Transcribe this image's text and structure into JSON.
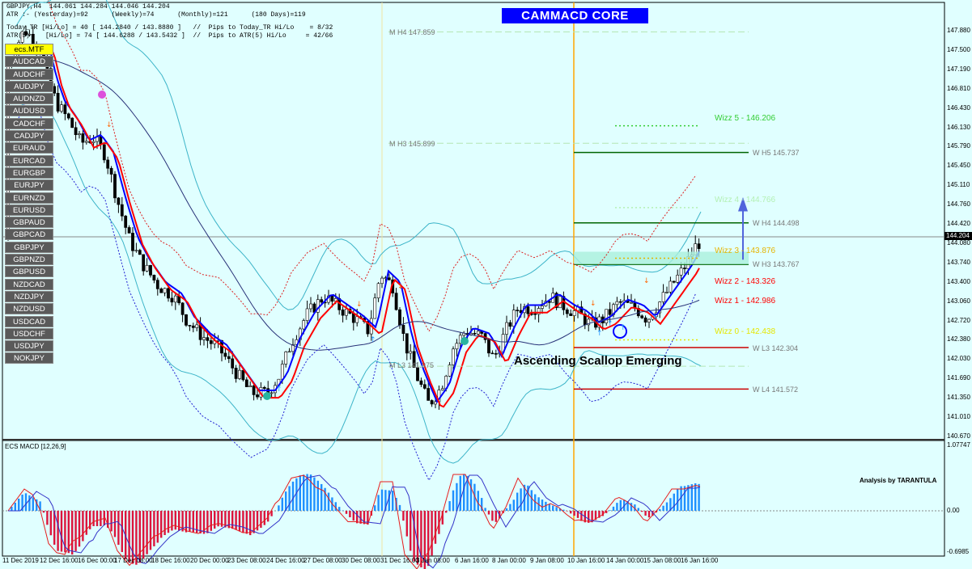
{
  "header": {
    "line1": "GBPJPY,H4  144.061 144.284 144.046 144.204",
    "line2": "ATR :- (Yesterday)=92      (Weekly)=74      (Monthly)=121      (180 Days)=119",
    "line3": "Today_TR [Hi/Lo] = 40 [ 144.2840 / 143.8880 ]   //  Pips to Today_TR Hi/Lo    = 8/32",
    "line4": "ATR(5)    [Hi/Lo] = 74 [ 144.6288 / 143.5432 ]  //  Pips to ATR(5) Hi/Lo     = 42/66"
  },
  "title": "CAMMACD CORE",
  "symbols": [
    "ecs.MTF",
    "AUDCAD",
    "AUDCHF",
    "AUDJPY",
    "AUDNZD",
    "AUDUSD",
    "CADCHF",
    "CADJPY",
    "EURAUD",
    "EURCAD",
    "EURGBP",
    "EURJPY",
    "EURNZD",
    "EURUSD",
    "GBPAUD",
    "GBPCAD",
    "GBPJPY",
    "GBPNZD",
    "GBPUSD",
    "NZDCAD",
    "NZDJPY",
    "NZDUSD",
    "USDCAD",
    "USDCHF",
    "USDJPY",
    "NOKJPY"
  ],
  "price_ticks": [
    "147.880",
    "147.500",
    "147.190",
    "146.810",
    "146.430",
    "146.130",
    "145.790",
    "145.450",
    "145.110",
    "144.760",
    "144.420",
    "144.080",
    "143.740",
    "143.400",
    "143.060",
    "142.720",
    "142.380",
    "142.030",
    "141.690",
    "141.350",
    "141.010",
    "140.670"
  ],
  "current_price": "144.204",
  "time_ticks": [
    "11 Dec 2019",
    "12 Dec 16:00",
    "16 Dec 00:00",
    "17 Dec 08:00",
    "18 Dec 16:00",
    "20 Dec 00:00",
    "23 Dec 08:00",
    "24 Dec 16:00",
    "27 Dec 08:00",
    "30 Dec 08:00",
    "31 Dec 16:00",
    "3 Jan 08:00",
    "6 Jan 16:00",
    "8 Jan 00:00",
    "9 Jan 08:00",
    "10 Jan 16:00",
    "14 Jan 00:00",
    "15 Jan 08:00",
    "16 Jan 16:00"
  ],
  "levels": {
    "m_h4": "M  H4 147.859",
    "m_h3": "M  H3 145.899",
    "m_l3": "M  L3 141.975",
    "w_h5": "W  H5 145.737",
    "w_h4": "W  H4 144.498",
    "w_h3": "W  H3 143.767",
    "w_l3": "W  L3 142.304",
    "w_l4": "W  L4 141.572"
  },
  "wizz": {
    "w5": "Wizz 5 - 146.206",
    "w4": "Wizz 4 - 144.766",
    "w3": "Wizz 3 - 143.876",
    "w2": "Wizz 2 - 143.326",
    "w1": "Wizz 1 - 142.986",
    "w0": "Wizz 0 - 142.438"
  },
  "annotation": "Ascending Scallop Emerging",
  "macd": {
    "title": "ECS MACD [12,26,9]",
    "ticks": [
      "1.07747",
      "0.00",
      "-0.6985"
    ]
  },
  "analysis_credit": "Analysis by TARANTULA",
  "colors": {
    "background": "#e0ffff",
    "bull_candle": "#ffffff",
    "bear_candle": "#000000",
    "fast_ma": "#0000ff",
    "slow_ma": "#ff0000",
    "bollinger": "#3cb4c8",
    "orange_vline": "#ffa500",
    "histogram_up": "#1e90ff",
    "histogram_down": "#dc143c"
  }
}
